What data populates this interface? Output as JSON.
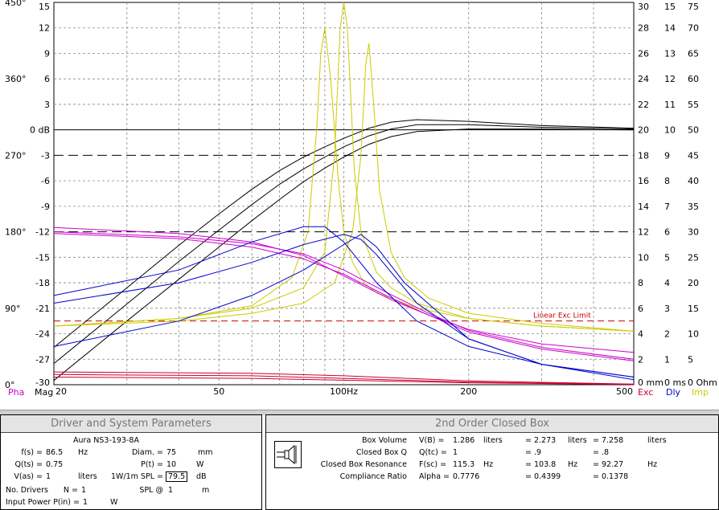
{
  "graph": {
    "phase_ticks": [
      "450°",
      "360°",
      "270°",
      "180°",
      "90°",
      "0°"
    ],
    "mag_ticks": [
      "15",
      "12",
      "9",
      "6",
      "3",
      "0 dB",
      "-3",
      "-6",
      "-9",
      "-12",
      "-15",
      "-18",
      "-21",
      "-24",
      "-27",
      "-30"
    ],
    "exc_ticks": [
      "30",
      "28",
      "26",
      "24",
      "22",
      "20",
      "18",
      "16",
      "14",
      "12",
      "10",
      "8",
      "6",
      "4",
      "2",
      "0 mm"
    ],
    "dly_ticks": [
      "15",
      "14",
      "13",
      "12",
      "11",
      "10",
      "9",
      "8",
      "7",
      "6",
      "5",
      "4",
      "3",
      "2",
      "1",
      "0 ms"
    ],
    "imp_ticks": [
      "75",
      "70",
      "65",
      "60",
      "55",
      "50",
      "45",
      "40",
      "35",
      "30",
      "25",
      "20",
      "15",
      "10",
      "5",
      "0 Ohm"
    ],
    "freq_ticks": [
      "20",
      "50",
      "100Hz",
      "200",
      "500"
    ],
    "axis_labels": {
      "pha": "Pha",
      "mag": "Mag",
      "exc": "Exc",
      "dly": "Dly",
      "imp": "Imp"
    },
    "linear_exc_limit_label": "Linear Exc Limit",
    "colors": {
      "phase": "#cc00cc",
      "magnitude": "#000000",
      "excursion": "#cc0033",
      "delay": "#0000cc",
      "impedance": "#cccc00",
      "limit": "#cc0000"
    }
  },
  "chart_data": {
    "type": "line",
    "xscale": "log",
    "xlim": [
      20,
      500
    ],
    "ylim": [
      -30,
      15
    ],
    "xlabel": "",
    "ylabel": "",
    "grid": true,
    "linear_exc_limit_mm": 5,
    "series": [
      {
        "kind": "magnitude",
        "x": [
          20,
          30,
          40,
          50,
          60,
          70,
          80,
          90,
          100,
          115,
          130,
          150,
          200,
          300,
          500
        ],
        "values": [
          -29.5,
          -22.5,
          -17.6,
          -13.8,
          -10.7,
          -8.2,
          -6.1,
          -4.5,
          -3.2,
          -1.7,
          -0.8,
          -0.2,
          0.1,
          0.1,
          0
        ]
      },
      {
        "kind": "magnitude",
        "x": [
          20,
          30,
          40,
          50,
          60,
          70,
          80,
          90,
          100,
          115,
          130,
          150,
          200,
          300,
          500
        ],
        "values": [
          -27.5,
          -20.5,
          -15.5,
          -11.8,
          -8.8,
          -6.4,
          -4.6,
          -3.2,
          -2.0,
          -0.7,
          0.1,
          0.6,
          0.6,
          0.3,
          0.1
        ]
      },
      {
        "kind": "magnitude",
        "x": [
          20,
          30,
          40,
          50,
          60,
          70,
          80,
          90,
          100,
          115,
          130,
          150,
          200,
          300,
          500
        ],
        "values": [
          -25.6,
          -18.6,
          -13.6,
          -9.9,
          -7.0,
          -4.8,
          -3.2,
          -2.0,
          -1.0,
          0.2,
          0.9,
          1.2,
          1.0,
          0.5,
          0.2
        ]
      },
      {
        "kind": "impedance",
        "x": [
          20,
          40,
          60,
          75,
          82,
          86,
          88,
          90,
          93,
          97,
          100,
          105,
          112,
          120,
          130,
          150,
          200,
          300,
          500
        ],
        "values": [
          11.5,
          13,
          15.5,
          21,
          30,
          50,
          65,
          70,
          60,
          40,
          30,
          24,
          20,
          18,
          17,
          15,
          13,
          11.5,
          10.5
        ]
      },
      {
        "kind": "impedance",
        "x": [
          20,
          40,
          60,
          80,
          90,
          95,
          98,
          100,
          102,
          106,
          110,
          120,
          130,
          150,
          200,
          300,
          500
        ],
        "values": [
          11.5,
          13,
          15,
          19,
          26,
          45,
          70,
          78,
          70,
          42,
          30,
          22,
          19,
          16,
          13,
          11.5,
          10.5
        ]
      },
      {
        "kind": "impedance",
        "x": [
          20,
          40,
          60,
          80,
          95,
          105,
          110,
          113,
          115,
          118,
          122,
          130,
          140,
          160,
          200,
          300,
          500
        ],
        "values": [
          11.5,
          12.5,
          14,
          16,
          20,
          30,
          45,
          63,
          67,
          55,
          38,
          26,
          21,
          17,
          14,
          12,
          10.5
        ]
      },
      {
        "kind": "phase",
        "x": [
          20,
          40,
          60,
          80,
          100,
          130,
          160,
          200,
          300,
          500
        ],
        "values": [
          185,
          178,
          168,
          152,
          128,
          100,
          82,
          65,
          48,
          38
        ]
      },
      {
        "kind": "phase",
        "x": [
          20,
          40,
          60,
          80,
          100,
          130,
          160,
          200,
          300,
          500
        ],
        "values": [
          180,
          174,
          166,
          154,
          135,
          106,
          84,
          64,
          44,
          30
        ]
      },
      {
        "kind": "phase",
        "x": [
          20,
          40,
          60,
          80,
          100,
          130,
          160,
          200,
          300,
          500
        ],
        "values": [
          178,
          172,
          162,
          148,
          130,
          102,
          82,
          62,
          42,
          28
        ]
      },
      {
        "kind": "delay",
        "x": [
          20,
          40,
          60,
          80,
          90,
          100,
          120,
          150,
          200,
          300,
          500
        ],
        "values": [
          3.5,
          4.5,
          5.6,
          6.2,
          6.2,
          5.6,
          4.0,
          2.5,
          1.5,
          0.8,
          0.3
        ]
      },
      {
        "kind": "delay",
        "x": [
          20,
          40,
          60,
          80,
          100,
          110,
          120,
          150,
          200,
          300,
          500
        ],
        "values": [
          3.2,
          4.0,
          4.8,
          5.5,
          5.9,
          5.7,
          5.1,
          3.2,
          1.8,
          0.8,
          0.3
        ]
      },
      {
        "kind": "delay",
        "x": [
          20,
          40,
          60,
          80,
          100,
          110,
          120,
          140,
          200,
          300,
          500
        ],
        "values": [
          1.5,
          2.5,
          3.5,
          4.5,
          5.5,
          5.9,
          5.4,
          4.0,
          1.8,
          0.8,
          0.2
        ]
      },
      {
        "kind": "excursion",
        "x": [
          20,
          60,
          100,
          200,
          500
        ],
        "values": [
          1.0,
          0.9,
          0.7,
          0.3,
          0.05
        ]
      },
      {
        "kind": "excursion",
        "x": [
          20,
          60,
          100,
          200,
          500
        ],
        "values": [
          0.8,
          0.7,
          0.5,
          0.2,
          0.03
        ]
      },
      {
        "kind": "excursion",
        "x": [
          20,
          60,
          100,
          200,
          500
        ],
        "values": [
          0.6,
          0.5,
          0.35,
          0.15,
          0.02
        ]
      }
    ]
  },
  "left_panel": {
    "title": "Driver and System Parameters",
    "driver_name": "Aura NS3-193-8A",
    "fs_label": "f(s) =",
    "fs_value": "86.5",
    "fs_unit": "Hz",
    "diam_label": "Diam. =",
    "diam_value": "75",
    "diam_unit": "mm",
    "qts_label": "Q(ts) =",
    "qts_value": "0.75",
    "pt_label": "P(t) =",
    "pt_value": "10",
    "pt_unit": "W",
    "vas_label": "V(as) =",
    "vas_value": "1",
    "vas_unit": "liters",
    "spl_label": "1W/1m SPL =",
    "spl_value": "79.5",
    "spl_unit": "dB",
    "ndrivers_label": "No. Drivers",
    "n_label": "N =",
    "n_value": "1",
    "splat_label": "SPL @",
    "splat_value": "1",
    "splat_unit": "m",
    "inpower_label": "Input Power",
    "pin_label": "P(in) =",
    "pin_value": "1",
    "pin_unit": "W"
  },
  "right_panel": {
    "title": "2nd Order Closed Box",
    "rows": [
      {
        "label": "Box Volume",
        "sym": "V(B) =",
        "v1": "1.286",
        "u1": "liters",
        "v2": "= 2.273",
        "u2": "liters",
        "v3": "= 7.258",
        "u3": "liters"
      },
      {
        "label": "Closed Box Q",
        "sym": "Q(tc) =",
        "v1": "1",
        "u1": "",
        "v2": "= .9",
        "u2": "",
        "v3": "= .8",
        "u3": ""
      },
      {
        "label": "Closed Box Resonance",
        "sym": "F(sc) =",
        "v1": "115.3",
        "u1": "Hz",
        "v2": "= 103.8",
        "u2": "Hz",
        "v3": "= 92.27",
        "u3": "Hz"
      },
      {
        "label": "Compliance Ratio",
        "sym": "Alpha =",
        "v1": "0.7776",
        "u1": "",
        "v2": "= 0.4399",
        "u2": "",
        "v3": "= 0.1378",
        "u3": ""
      }
    ]
  }
}
